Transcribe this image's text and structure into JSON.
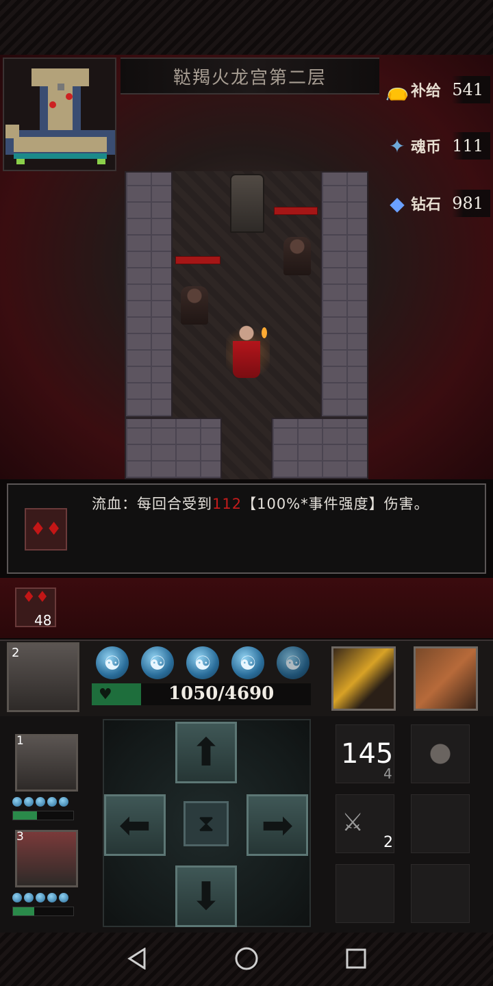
{
  "location": {
    "name": "鞑羯火龙宫第二层"
  },
  "resources": [
    {
      "label": "补给",
      "value": "541",
      "icon": "supply-bag-icon"
    },
    {
      "label": "魂币",
      "value": "111",
      "icon": "soul-coin-icon"
    },
    {
      "label": "钻石",
      "value": "981",
      "icon": "diamond-icon"
    }
  ],
  "event": {
    "prefix": "流血：每回合受到",
    "damage": "112",
    "suffix": "【100%*事件强度】伤害。",
    "icon": "bleed-icon"
  },
  "status": {
    "bleed_count": "48"
  },
  "hero": {
    "slot_number": "2",
    "hp_text": "1050/4690",
    "hp_fraction": 0.224,
    "sanity_orbs": 5
  },
  "party": [
    {
      "slot_number": "1",
      "hp_fraction": 0.4
    },
    {
      "slot_number": "3",
      "hp_fraction": 0.35
    }
  ],
  "inventory": {
    "torch_count": "145",
    "torch_sub": "4",
    "crossbow_count": "2"
  }
}
